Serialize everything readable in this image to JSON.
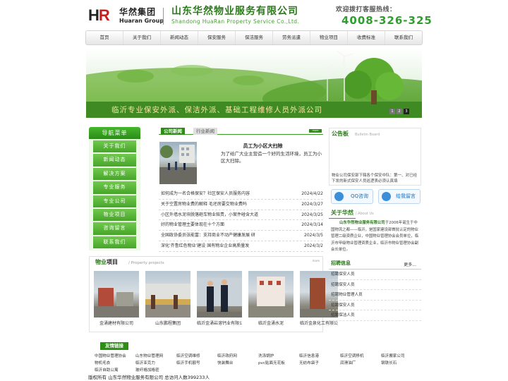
{
  "header": {
    "logo_cn": "华然集团",
    "logo_en": "Huaran Group",
    "company_cn": "山东华然物业服务有限公司",
    "company_en": "Shandong HuaRan  Property Service Co.,Ltd.",
    "hotline_label": "欢迎拨打客服热线：",
    "hotline": "4008-326-325"
  },
  "nav": [
    "首页",
    "关于我们",
    "新闻动态",
    "保安服务",
    "保洁服务",
    "劳务派遣",
    "物业项目",
    "收费标准",
    "联系我们"
  ],
  "banner": {
    "slogan": "临沂专业保安外派、保洁外派、基础工程维修人员外派公司",
    "pages": [
      "1",
      "2",
      "3"
    ]
  },
  "sidebar": {
    "title": "导航菜单",
    "items": [
      "关于我们",
      "新闻动态",
      "解决方案",
      "专业服务",
      "专业公司",
      "物业项目",
      "咨询留言",
      "联系我们"
    ]
  },
  "news": {
    "tabs": [
      "公司新闻",
      "行业新闻"
    ],
    "more": "more",
    "featured_title": "员工为小区大扫除",
    "featured_desc": "为了给广大业主营造一个好的生活环境，员工为小区大扫除。",
    "items": [
      {
        "title": "如何成为一名合格保安？社区保安人员服务内容",
        "date": "2024/4/22"
      },
      {
        "title": "关于空置房物业费的解释 毛坯房要交物业费吗",
        "date": "2024/3/27"
      },
      {
        "title": "小区外墙水泥块脱落砸车物业赔责，小案件碰含大道",
        "date": "2024/3/25"
      },
      {
        "title": "好的物业管理主要体现在十个方面",
        "date": "2024/3/14"
      },
      {
        "title": "全国政协委员张能富：支持商业不动产健康发展 研",
        "date": "2024/3/5"
      },
      {
        "title": "深化'齐鲁红色物业'建设 国有物业企业高质量发",
        "date": "2024/3/2"
      }
    ]
  },
  "notice": {
    "title": "公告板",
    "subtitle": "Bulletin Board",
    "body": "物业公司保安部下辖各个保安中队：第一、对已经下发的新式保安人员巡逻表必须认真填"
  },
  "contact": {
    "qq": "QQ咨询",
    "message": "给我留言"
  },
  "about": {
    "title": "关于华然",
    "subtitle": "/ About Us",
    "company": "山东华然物业服务有限公司",
    "body": "于2006年诞生于中国物流之都——临沂，是国家建设部首批认定的物业管理二级资质企业，中国物业管理协会会员单位，临沂市甲级物业管理资质企业，临沂市物业管理协会副会长单位。"
  },
  "projects": {
    "title_a": "物业",
    "title_b": "项目",
    "subtitle": "/ Property projects",
    "more": "more",
    "items": [
      "金涌建材有限公司",
      "山东鹏程集团",
      "临沂金涌岩溶钙业有限公司",
      "临沂金涌水泥",
      "临沂金泉化工有限公司"
    ]
  },
  "jobs": {
    "title": "招聘信息",
    "more": "更多...",
    "items": [
      "招聘保安人员",
      "招聘保安人员",
      "招聘物业管理人员",
      "招聘保安人员",
      "招聘保洁人员"
    ]
  },
  "links": {
    "title": "友情链接",
    "items": [
      "中国物业管理协会",
      "山东物业管理网",
      "临沂空调维修",
      "临沂政府网",
      "洗涤锅炉",
      "临沂信息港",
      "临沂空调移机",
      "临沂搬家公司",
      "物机毛衣",
      "临沂亚克力",
      "临沂手机靓号",
      "快装舞台",
      "pvc贴面无花板",
      "无纺布袋子",
      "润滑油厂",
      "钢铁长石",
      "临沂自助公寓",
      "玻纤格加格密"
    ]
  },
  "footer": "版权所有 山东华然物业服务有限公司   总访问人数399233人"
}
